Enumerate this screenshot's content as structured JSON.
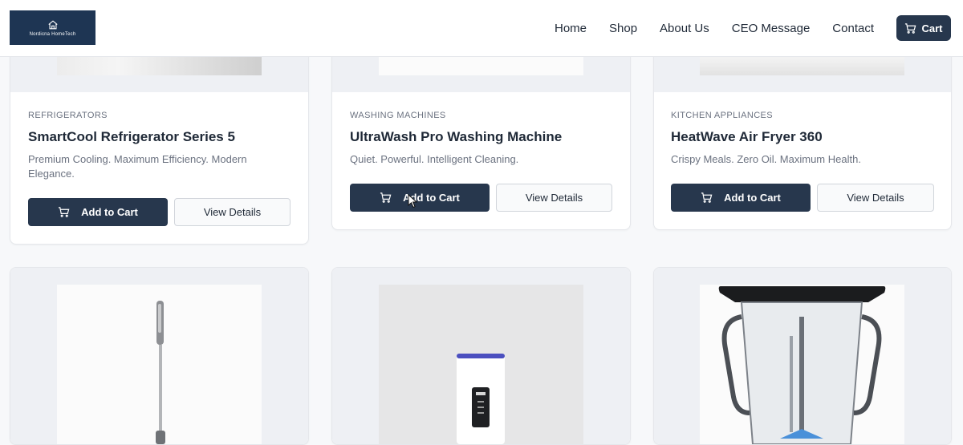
{
  "brand": {
    "name": "Nordicna HomeTech"
  },
  "nav": {
    "items": [
      "Home",
      "Shop",
      "About Us",
      "CEO Message",
      "Contact"
    ],
    "cart_label": "Cart"
  },
  "products": [
    {
      "category": "REFRIGERATORS",
      "title": "SmartCool Refrigerator Series 5",
      "description": "Premium Cooling. Maximum Efficiency. Modern Elegance.",
      "add_label": "Add to Cart",
      "details_label": "View Details"
    },
    {
      "category": "WASHING MACHINES",
      "title": "UltraWash Pro Washing Machine",
      "description": "Quiet. Powerful. Intelligent Cleaning.",
      "add_label": "Add to Cart",
      "details_label": "View Details"
    },
    {
      "category": "KITCHEN APPLIANCES",
      "title": "HeatWave Air Fryer 360",
      "description": "Crispy Meals. Zero Oil. Maximum Health.",
      "add_label": "Add to Cart",
      "details_label": "View Details"
    }
  ],
  "colors": {
    "primary": "#27374d",
    "logo_bg": "#1e3553",
    "background": "#f7f8fa"
  }
}
